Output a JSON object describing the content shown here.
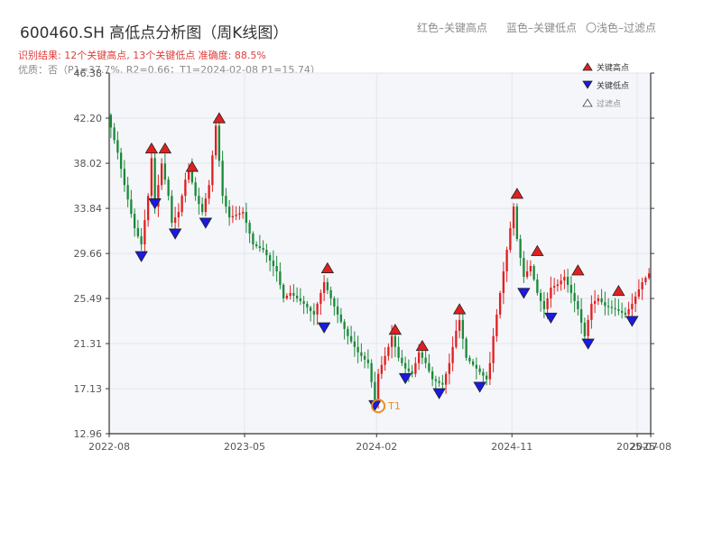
{
  "title": "600460.SH 高低点分析图（周K线图）",
  "subtitle": "识别结果: 12个关键高点, 13个关键低点  准确度: 88.5%",
  "quality_line": "优质：否（P1=37.7%, R2=0.66；T1=2024-02-08 P1=15.74）",
  "top_notes": [
    "红色–关键高点",
    "蓝色–关键低点",
    "〇浅色–过滤点"
  ],
  "legend": [
    {
      "label": "关键高点",
      "symbol": "triangle-up",
      "color": "#e02020"
    },
    {
      "label": "关键低点",
      "symbol": "triangle-down",
      "color": "#1a1ae0"
    },
    {
      "label": "过滤点",
      "symbol": "triangle-up-hollow",
      "color": "#ffffff"
    }
  ],
  "colors": {
    "up": "#e02020",
    "down": "#1a8a3a",
    "high_marker": "#e02020",
    "low_marker": "#1a1ae0",
    "t1": "#f08c1e",
    "plot_bg": "#f5f6fa",
    "grid": "#e4e6ec"
  },
  "chart_data": {
    "type": "candlestick",
    "title": "600460.SH 高低点分析图（周K线图）",
    "xlabel": "",
    "ylabel": "",
    "ylim": [
      12.96,
      46.38
    ],
    "xlim": [
      0,
      160
    ],
    "y_ticks": [
      12.96,
      17.13,
      21.31,
      25.49,
      29.66,
      33.84,
      38.02,
      42.2,
      46.38
    ],
    "y_tick_labels": [
      "12.96",
      "17.13",
      "21.31",
      "25.49",
      "29.66",
      "33.84",
      "38.02",
      "42.20",
      "46.38"
    ],
    "x_ticks": [
      {
        "week": 0,
        "label": "2022-08"
      },
      {
        "week": 40,
        "label": "2023-05"
      },
      {
        "week": 79,
        "label": "2024-02"
      },
      {
        "week": 119,
        "label": "2024-11"
      },
      {
        "week": 156,
        "label": "2025-07"
      },
      {
        "week": 160,
        "label": "2025-08"
      }
    ],
    "grid": true,
    "legend_position": "top-right",
    "anchors": [
      [
        0,
        42.5
      ],
      [
        3,
        39.0
      ],
      [
        5,
        36.0
      ],
      [
        8,
        32.0
      ],
      [
        10,
        30.5
      ],
      [
        12,
        35.0
      ],
      [
        13,
        38.5
      ],
      [
        14,
        34.0
      ],
      [
        16,
        38.0
      ],
      [
        18,
        35.0
      ],
      [
        19,
        32.5
      ],
      [
        21,
        33.5
      ],
      [
        23,
        36.5
      ],
      [
        24,
        37.5
      ],
      [
        26,
        35.0
      ],
      [
        28,
        33.5
      ],
      [
        30,
        36.0
      ],
      [
        32,
        41.5
      ],
      [
        34,
        35.0
      ],
      [
        36,
        33.0
      ],
      [
        40,
        33.5
      ],
      [
        43,
        30.5
      ],
      [
        46,
        30.0
      ],
      [
        50,
        28.0
      ],
      [
        52,
        25.5
      ],
      [
        54,
        26.0
      ],
      [
        58,
        25.0
      ],
      [
        61,
        24.0
      ],
      [
        64,
        27.0
      ],
      [
        66,
        25.5
      ],
      [
        68,
        24.0
      ],
      [
        71,
        22.0
      ],
      [
        74,
        20.5
      ],
      [
        77,
        19.5
      ],
      [
        79,
        16.0
      ],
      [
        80,
        18.5
      ],
      [
        83,
        21.0
      ],
      [
        84,
        22.0
      ],
      [
        86,
        20.0
      ],
      [
        88,
        19.0
      ],
      [
        90,
        18.5
      ],
      [
        92,
        20.5
      ],
      [
        94,
        19.5
      ],
      [
        96,
        18.0
      ],
      [
        99,
        17.5
      ],
      [
        101,
        19.5
      ],
      [
        103,
        22.5
      ],
      [
        104,
        23.5
      ],
      [
        106,
        20.0
      ],
      [
        109,
        19.0
      ],
      [
        112,
        18.0
      ],
      [
        113,
        19.5
      ],
      [
        114,
        22.0
      ],
      [
        116,
        26.0
      ],
      [
        118,
        30.0
      ],
      [
        119,
        32.0
      ],
      [
        120,
        34.0
      ],
      [
        121,
        31.0
      ],
      [
        123,
        27.5
      ],
      [
        125,
        28.5
      ],
      [
        127,
        26.0
      ],
      [
        129,
        24.5
      ],
      [
        131,
        26.5
      ],
      [
        133,
        26.8
      ],
      [
        135,
        27.5
      ],
      [
        137,
        26.0
      ],
      [
        139,
        24.5
      ],
      [
        141,
        22.0
      ],
      [
        143,
        25.0
      ],
      [
        145,
        25.5
      ],
      [
        147,
        24.8
      ],
      [
        150,
        24.5
      ],
      [
        153,
        24.0
      ],
      [
        155,
        25.0
      ],
      [
        158,
        27.0
      ],
      [
        160,
        27.8
      ]
    ],
    "key_highs": [
      {
        "week": 12,
        "price": 38.8
      },
      {
        "week": 16,
        "price": 38.8
      },
      {
        "week": 24,
        "price": 37.1
      },
      {
        "week": 32,
        "price": 41.6
      },
      {
        "week": 64,
        "price": 27.7
      },
      {
        "week": 84,
        "price": 22.0
      },
      {
        "week": 92,
        "price": 20.5
      },
      {
        "week": 103,
        "price": 23.9
      },
      {
        "week": 120,
        "price": 34.6
      },
      {
        "week": 126,
        "price": 29.3
      },
      {
        "week": 138,
        "price": 27.5
      },
      {
        "week": 150,
        "price": 25.6
      }
    ],
    "key_lows": [
      {
        "week": 9,
        "price": 30.0
      },
      {
        "week": 13,
        "price": 34.9
      },
      {
        "week": 19,
        "price": 32.1
      },
      {
        "week": 28,
        "price": 33.1
      },
      {
        "week": 63,
        "price": 23.4
      },
      {
        "week": 78,
        "price": 16.2
      },
      {
        "week": 87,
        "price": 18.7
      },
      {
        "week": 97,
        "price": 17.3
      },
      {
        "week": 109,
        "price": 17.9
      },
      {
        "week": 122,
        "price": 26.6
      },
      {
        "week": 130,
        "price": 24.3
      },
      {
        "week": 141,
        "price": 21.9
      },
      {
        "week": 154,
        "price": 24.0
      }
    ],
    "t1": {
      "label": "T1",
      "week": 79,
      "price": 16.2
    }
  }
}
